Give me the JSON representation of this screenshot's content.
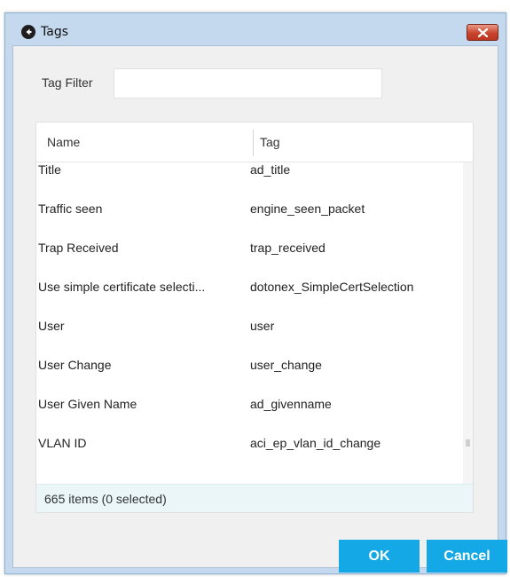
{
  "window": {
    "title": "Tags",
    "icon": "back-arrow-icon",
    "close_icon": "close-icon"
  },
  "filter": {
    "label": "Tag Filter",
    "value": "",
    "placeholder": ""
  },
  "table": {
    "columns": [
      "Name",
      "Tag"
    ],
    "rows": [
      {
        "name": "Title",
        "tag": "ad_title"
      },
      {
        "name": "Traffic seen",
        "tag": "engine_seen_packet"
      },
      {
        "name": "Trap Received",
        "tag": "trap_received"
      },
      {
        "name": "Use simple certificate selecti...",
        "tag": "dotonex_SimpleCertSelection"
      },
      {
        "name": "User",
        "tag": "user"
      },
      {
        "name": "User Change",
        "tag": "user_change"
      },
      {
        "name": "User Given Name",
        "tag": "ad_givenname"
      },
      {
        "name": "VLAN ID",
        "tag": "aci_ep_vlan_id_change"
      }
    ],
    "scroll_position": 0.88
  },
  "status": {
    "text": "665 items (0 selected)"
  },
  "buttons": {
    "ok": "OK",
    "cancel": "Cancel"
  },
  "colors": {
    "accent": "#14a8e6",
    "frame": "#c5d9ee",
    "status_bg": "#eaf6f8",
    "close": "#c9442c"
  }
}
